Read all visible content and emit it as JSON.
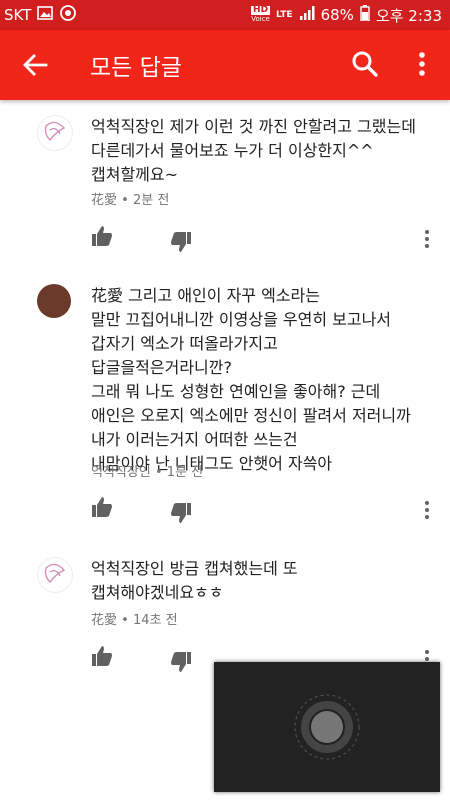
{
  "status_bar": {
    "carrier": "SKT",
    "hd_label": "HD",
    "voice_label": "Voice",
    "lte_label": "LTE",
    "battery_pct": "68%",
    "time": "오후 2:33"
  },
  "app_bar": {
    "title": "모든 답글"
  },
  "comments": [
    {
      "text": "억척직장인 제가 이런 것 까진 안할려고 그랬는데\n다른데가서 물어보죠 누가 더 이상한지^^\n캡쳐할께요~",
      "author": "花愛",
      "time": "2분 전"
    },
    {
      "text": "花愛 그리고 애인이 자꾸 엑소라는\n말만 끄집어내니깐 이영상을 우연히 보고나서\n갑자기 엑소가 떠올라가지고\n답글을적은거라니깐?\n그래 뭐 나도 성형한 연예인을 좋아해? 근데\n애인은 오로지 엑소에만 정신이 팔려서 저러니까\n내가 이러는거지 어떠한 쓰는건\n내맘이야 난 니태그도 안햇어 자쓱아",
      "author": "억척직장인",
      "time": "1분 전"
    },
    {
      "text": "억척직장인 방금 캡쳐했는데 또\n캡쳐해야겠네요ㅎㅎ",
      "author": "花愛",
      "time": "14초 전"
    }
  ],
  "meta_separator": "•",
  "colors": {
    "status_bar": "#d11f1f",
    "app_bar": "#f2251b",
    "icon_gray": "#616161"
  }
}
